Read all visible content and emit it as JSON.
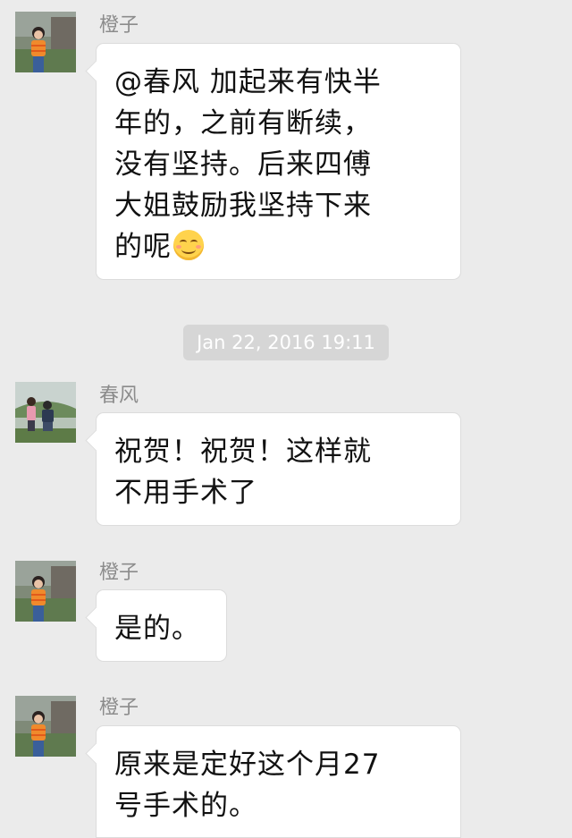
{
  "timestamp": "Jan 22, 2016 19:11",
  "messages": [
    {
      "sender": "橙子",
      "avatar": "person-avatar",
      "lines": [
        "@春风 加起来有快半",
        "年的，之前有断续，",
        "没有坚持。后来四傅",
        "大姐鼓励我坚持下来",
        "的呢"
      ],
      "emoji": "smiling-face-icon"
    },
    {
      "sender": "春风",
      "avatar": "group-photo-avatar",
      "lines": [
        "祝贺！祝贺！这样就",
        "不用手术了"
      ]
    },
    {
      "sender": "橙子",
      "avatar": "person-avatar",
      "lines": [
        "是的。"
      ]
    },
    {
      "sender": "橙子",
      "avatar": "person-avatar",
      "lines": [
        "原来是定好这个月27",
        "号手术的。"
      ]
    }
  ]
}
